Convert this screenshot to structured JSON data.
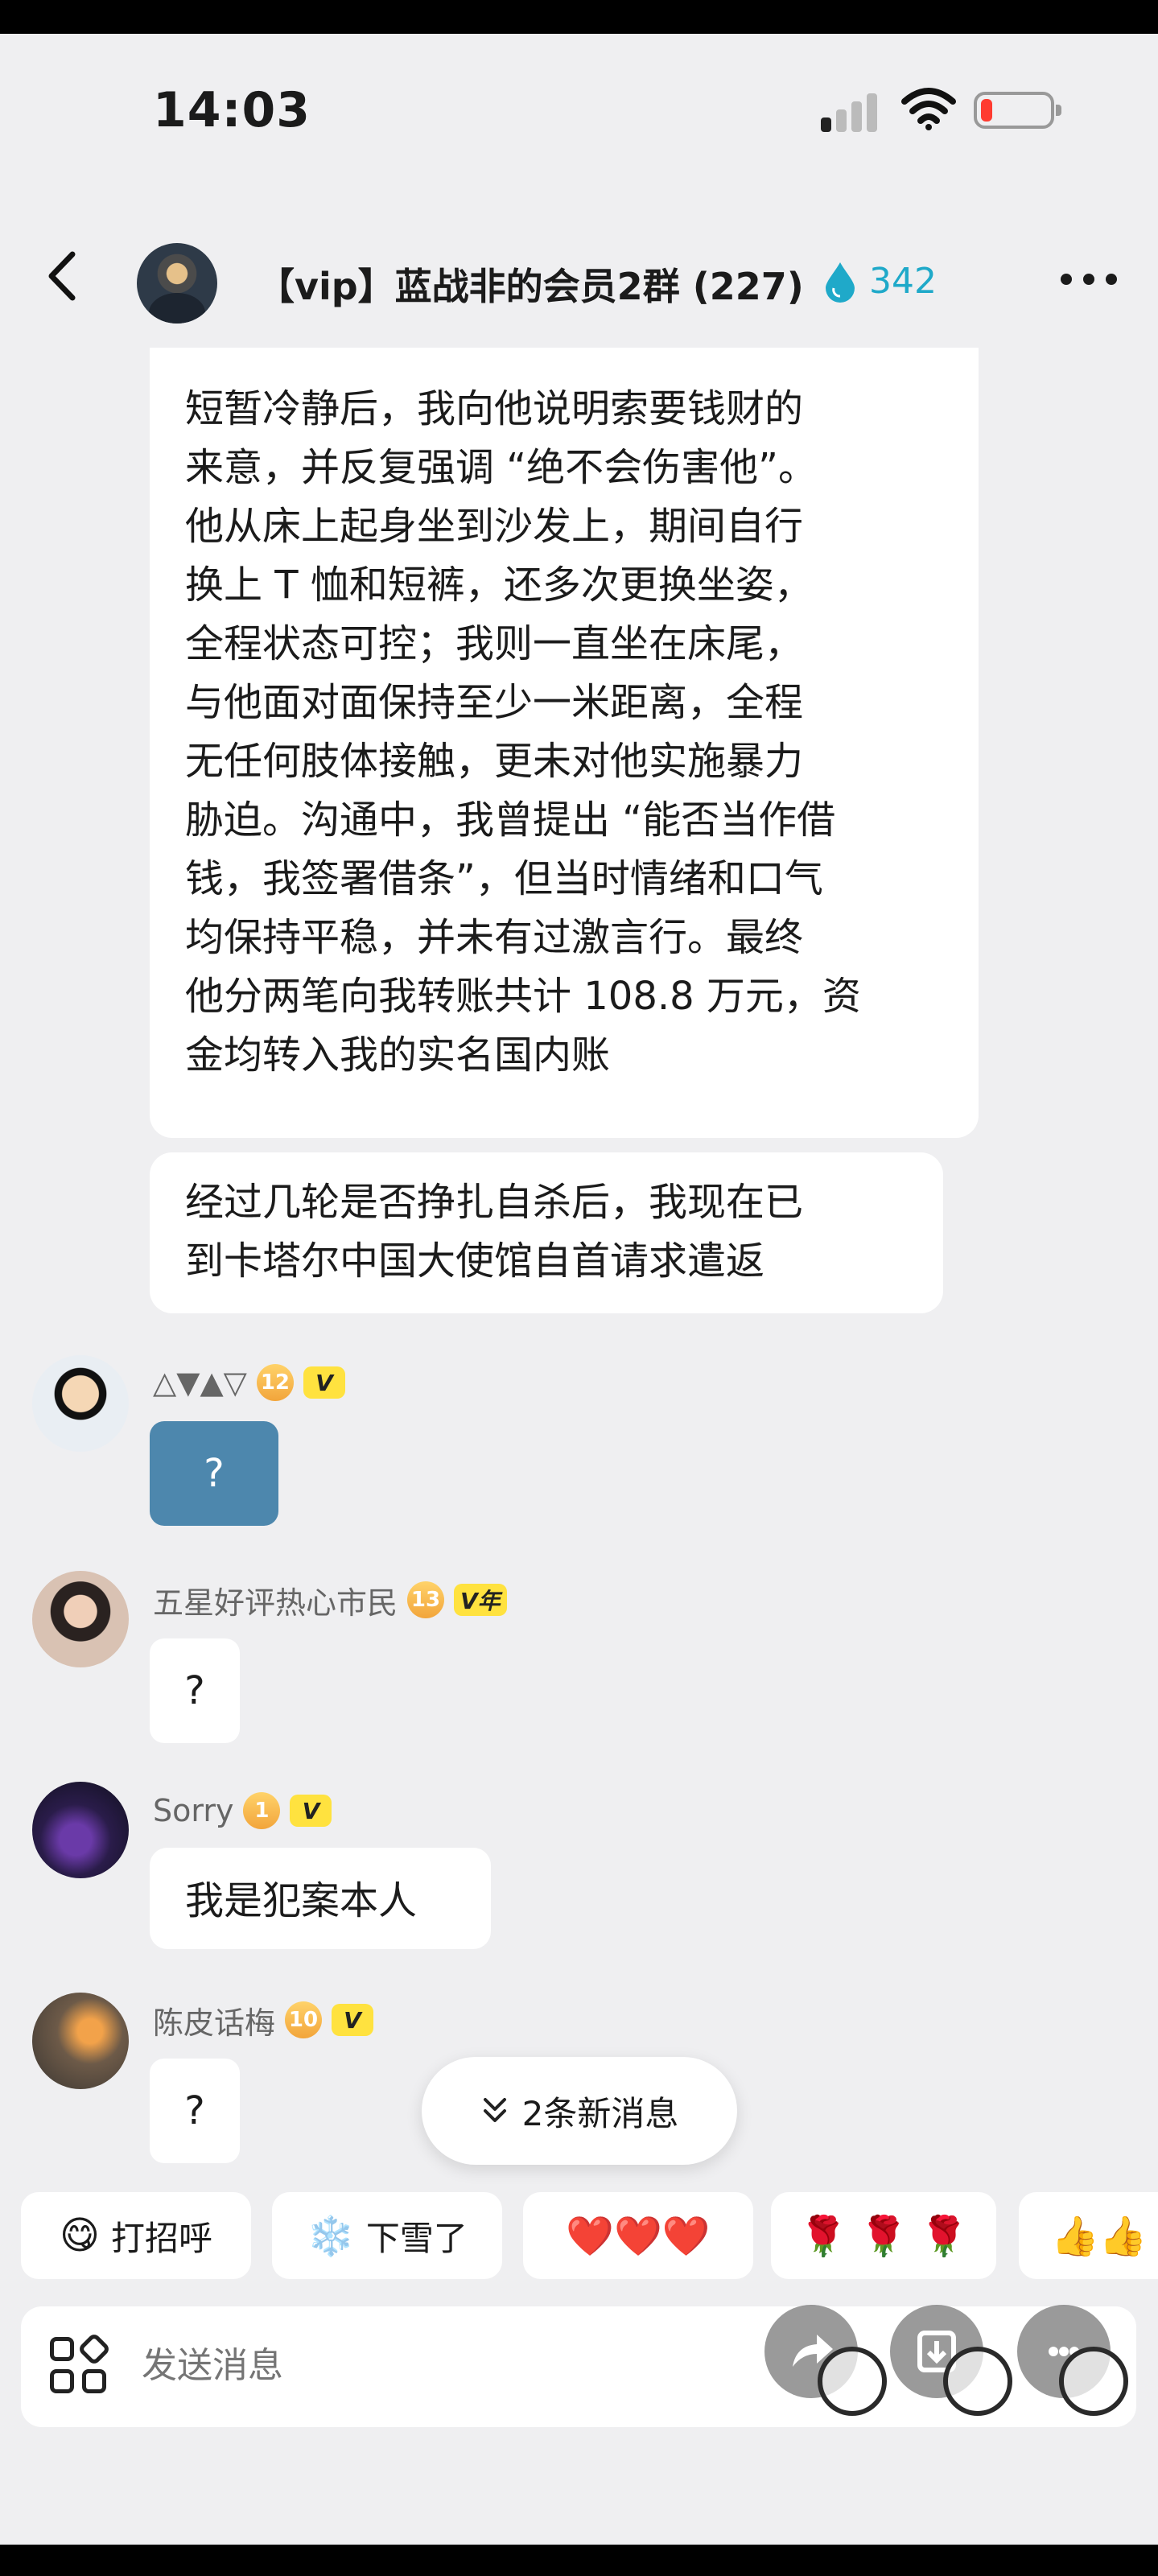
{
  "status_bar": {
    "time": "14:03"
  },
  "header": {
    "title": "【vip】蓝战非的会员2群 (227)",
    "fire_count": "342"
  },
  "messages": {
    "long_text_lines": [
      "短暂冷静后，我向他说明索要钱财的",
      "来意，并反复强调 “绝不会伤害他”。",
      "他从床上起身坐到沙发上，期间自行",
      "换上 T 恤和短裤，还多次更换坐姿，",
      "全程状态可控；我则一直坐在床尾，",
      "与他面对面保持至少一米距离，全程",
      "无任何肢体接触，更未对他实施暴力",
      "胁迫。沟通中，我曾提出 “能否当作借",
      "钱，我签署借条”，但当时情绪和口气",
      "均保持平稳，并未有过激言行。最终",
      "他分两笔向我转账共计 108.8 万元，资",
      "金均转入我的实名国内账"
    ],
    "second_lines": [
      "经过几轮是否挣扎自杀后，我现在已",
      "到卡塔尔中国大使馆自首请求遣返"
    ],
    "users": [
      {
        "name": "△▼▲▽",
        "level": "12",
        "badge": "V",
        "text": "?"
      },
      {
        "name": "五星好评热心市民",
        "level": "13",
        "badge": "V年",
        "text": "?"
      },
      {
        "name": "Sorry",
        "level": "1",
        "badge": "V",
        "text": "我是犯案本人"
      },
      {
        "name": "陈皮话梅",
        "level": "10",
        "badge": "V",
        "text": "?"
      }
    ]
  },
  "new_messages_pill": "2条新消息",
  "quick_replies": [
    {
      "icon": "😋",
      "label": "打招呼"
    },
    {
      "icon": "❄️",
      "label": "下雪了"
    },
    {
      "icon": "❤️❤️❤️",
      "label": ""
    },
    {
      "icon": "🌹 🌹 🌹",
      "label": ""
    },
    {
      "icon": "👍👍",
      "label": ""
    }
  ],
  "input": {
    "placeholder": "发送消息"
  },
  "colors": {
    "accent_blue": "#1fa9c9",
    "bubble_blue": "#4d87ad",
    "background": "#efeff1"
  }
}
